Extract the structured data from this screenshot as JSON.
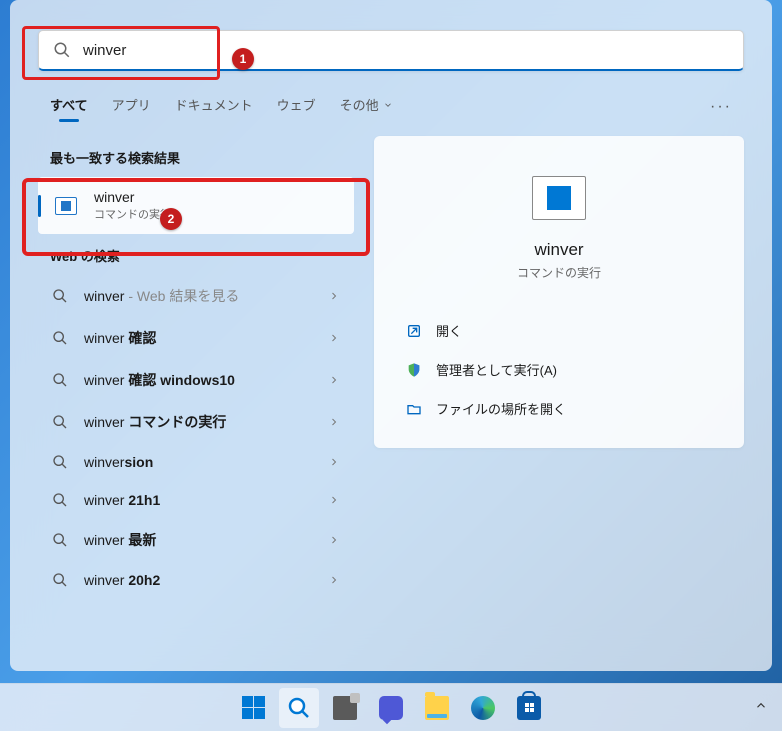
{
  "search": {
    "value": "winver"
  },
  "tabs": {
    "items": [
      "すべて",
      "アプリ",
      "ドキュメント",
      "ウェブ",
      "その他"
    ],
    "more": "···"
  },
  "results": {
    "best_match_header": "最も一致する検索結果",
    "top_result": {
      "title": "winver",
      "subtitle": "コマンドの実行"
    },
    "web_header": "Web の検索",
    "web_items": [
      {
        "prefix": "winver",
        "suffix": " - Web 結果を見る",
        "faded": true
      },
      {
        "prefix": "winver ",
        "bold": "確認"
      },
      {
        "prefix": "winver ",
        "bold": "確認 windows10"
      },
      {
        "prefix": "winver ",
        "bold": "コマンドの実行"
      },
      {
        "prefix": "winver",
        "bold": "sion"
      },
      {
        "prefix": "winver ",
        "bold": "21h1"
      },
      {
        "prefix": "winver ",
        "bold": "最新"
      },
      {
        "prefix": "winver ",
        "bold": "20h2"
      }
    ]
  },
  "preview": {
    "title": "winver",
    "subtitle": "コマンドの実行",
    "actions": [
      {
        "label": "開く"
      },
      {
        "label": "管理者として実行(A)"
      },
      {
        "label": "ファイルの場所を開く"
      }
    ]
  },
  "annotations": {
    "b1": "1",
    "b2": "2"
  }
}
